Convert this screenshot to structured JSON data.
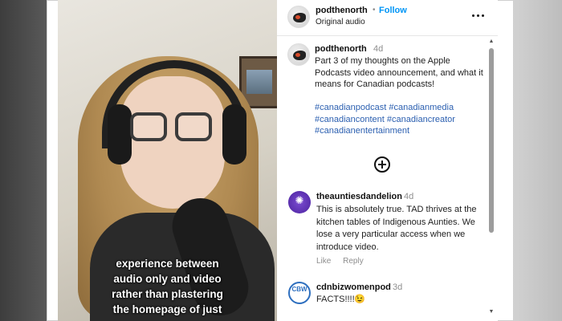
{
  "video": {
    "caption_lines": [
      "experience between",
      "audio only and video",
      "rather than plastering",
      "the homepage of just"
    ]
  },
  "header": {
    "username": "podthenorth",
    "separator": "•",
    "follow_label": "Follow",
    "audio_label": "Original audio",
    "more_icon": "more-horizontal-icon"
  },
  "post": {
    "username": "podthenorth",
    "time": "4d",
    "caption": "Part 3 of my thoughts on the Apple Podcasts video announcement, and what it means for Canadian podcasts!",
    "hashtags": [
      "#canadianpodcast",
      "#canadianmedia",
      "#canadiancontent",
      "#canadiancreator",
      "#canadianentertainment"
    ]
  },
  "load_more_icon": "plus-circle-icon",
  "comments": [
    {
      "username": "theauntiesdandelion",
      "time": "4d",
      "text": "This is absolutely true. TAD thrives at the kitchen tables of Indigenous Aunties. We lose a very particular access when we introduce video.",
      "like_label": "Like",
      "reply_label": "Reply"
    },
    {
      "username": "cdnbizwomenpod",
      "time": "3d",
      "text": "FACTS!!!!",
      "emoji": "😉",
      "avatar_text": "CBW"
    }
  ],
  "colors": {
    "link": "#0095f6",
    "hashtag": "#2b5fb0",
    "muted": "#8e8e8e"
  }
}
